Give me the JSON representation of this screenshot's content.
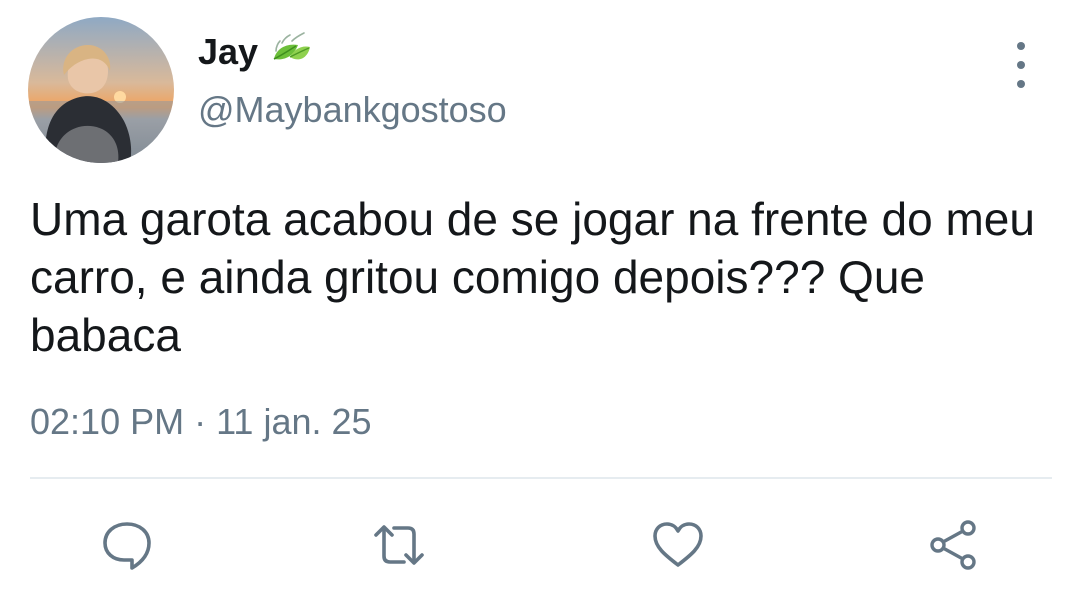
{
  "tweet": {
    "display_name": "Jay",
    "handle": "@Maybankgostoso",
    "text": "Uma garota acabou de se jogar na frente do meu carro, e ainda gritou comigo depois??? Que babaca",
    "timestamp": "02:10 PM · 11 jan. 25"
  },
  "icons": {
    "name_badge": "leaf-emoji-icon",
    "more": "vertical-ellipsis-icon",
    "reply": "speech-bubble-icon",
    "retweet": "retweet-icon",
    "like": "heart-icon",
    "share": "share-icon"
  },
  "colors": {
    "text": "#14171a",
    "secondary": "#657786",
    "divider": "#e6ecf0",
    "icon": "#657786"
  }
}
